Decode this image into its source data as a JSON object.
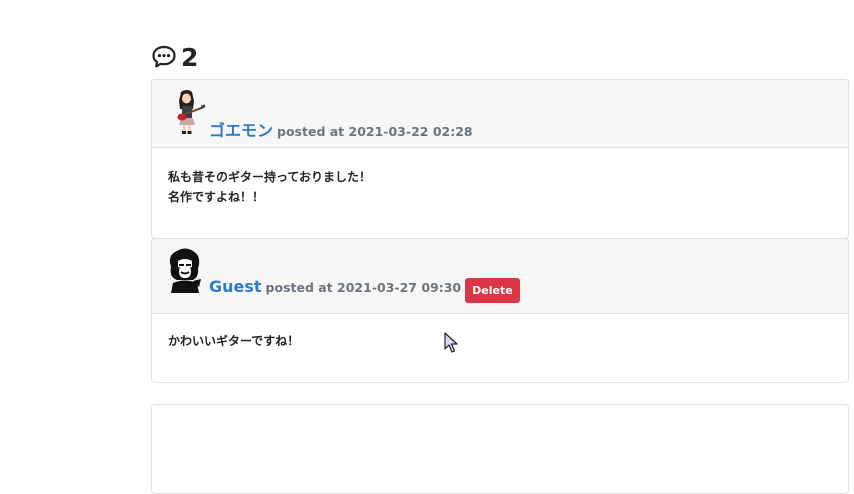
{
  "comments_section": {
    "count": "2",
    "icon": "comment-dots-icon"
  },
  "comments": [
    {
      "user_name": "ゴエモン",
      "posted_at": "posted at 2021-03-22 02:28",
      "text": "私も昔そのギター持っておりました！\n名作ですよね！！",
      "avatar": "guitarist-avatar-image"
    },
    {
      "user_name": "Guest",
      "posted_at": "posted at 2021-03-27 09:30",
      "delete_label": "Delete",
      "text": "かわいいギターですね！",
      "avatar": "portrait-avatar-image"
    }
  ],
  "colors": {
    "link": "#2b7bd0",
    "danger": "#dc3545",
    "muted": "#6c757d",
    "card_header_bg": "#f7f7f7",
    "border": "#dfe1e3"
  }
}
